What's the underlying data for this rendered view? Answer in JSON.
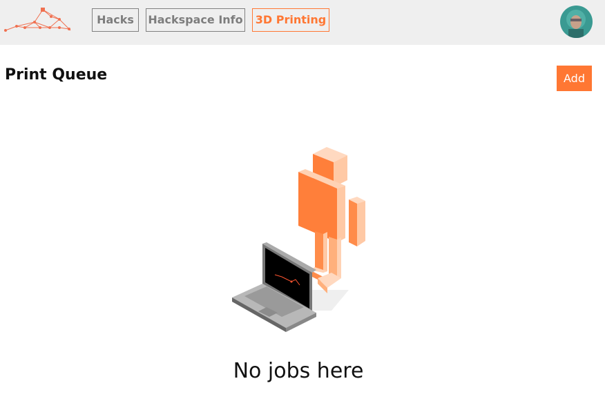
{
  "header": {
    "logo_icon": "network-graph-logo",
    "nav": [
      {
        "label": "Hacks",
        "active": false
      },
      {
        "label": "Hackspace Info",
        "active": false
      },
      {
        "label": "3D Printing",
        "active": true
      }
    ],
    "avatar_icon": "user-avatar"
  },
  "main": {
    "title": "Print Queue",
    "add_label": "Add",
    "empty_message": "No jobs here",
    "illustration_icon": "figure-and-laptop-illustration"
  },
  "colors": {
    "accent": "#ff7733",
    "header_bg": "#efefef",
    "nav_inactive": "#7d7d7d"
  }
}
